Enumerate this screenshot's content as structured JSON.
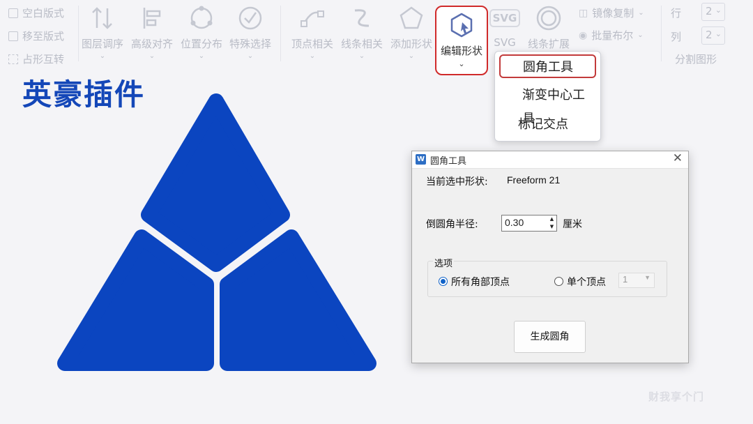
{
  "ribbon": {
    "left_items": [
      "空白版式",
      "移至版式",
      "占形互转"
    ],
    "buttons": [
      "图层调序",
      "高级对齐",
      "位置分布",
      "特殊选择",
      "顶点相关",
      "线条相关",
      "添加形状"
    ],
    "edit_shape": "编辑形状",
    "svg": "SVG",
    "svg_icon_text": "SVG",
    "line_extend": "线条扩展",
    "mirror_copy": "镜像复制",
    "batch_bool": "批量布尔",
    "row_label": "行",
    "row_value": "2",
    "col_label": "列",
    "col_value": "2",
    "split_shape": "分割图形"
  },
  "menu": {
    "items": [
      "圆角工具",
      "渐变中心工具",
      "标记交点"
    ]
  },
  "title": "英豪插件",
  "shape_color": "#0b45c0",
  "dialog": {
    "title": "圆角工具",
    "current_label": "当前选中形状:",
    "current_value": "Freeform 21",
    "radius_label": "倒圆角半径:",
    "radius_value": "0.30",
    "unit": "厘米",
    "options_legend": "选项",
    "opt_all": "所有角部顶点",
    "opt_single": "单个顶点",
    "single_value": "1",
    "generate": "生成圆角"
  },
  "watermark": "财我享个门"
}
